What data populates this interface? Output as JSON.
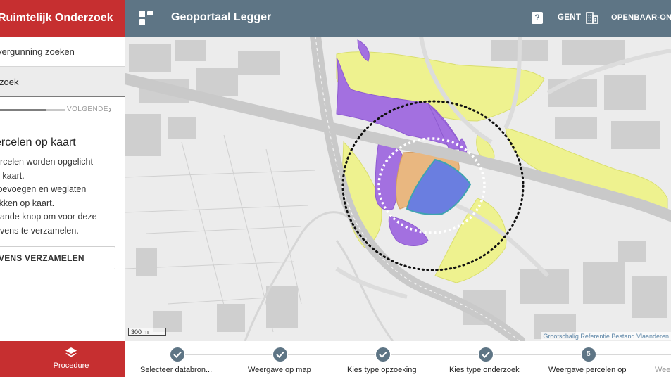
{
  "sidebar": {
    "header_title": "Ruimtelijk Onderzoek",
    "search_text": "vergunning zoeken",
    "step_text": "zoek",
    "next_label": "VOLGENDE",
    "progress": 0.72,
    "panel_title": "ercelen op kaart",
    "panel_lines": [
      "ercelen worden opgelicht",
      "p kaart.",
      " toevoegen en weglaten",
      "likken op kaart.",
      "aande knop om voor deze",
      "evens te verzamelen."
    ],
    "collect_button": "VENS VERZAMELEN",
    "footer_label": "Procedure",
    "footer_icon": "layers-icon"
  },
  "topbar": {
    "title": "Geoportaal Legger",
    "help_icon": "help-icon",
    "help_glyph": "?",
    "city": "GENT",
    "city_icon": "building-icon",
    "mode": "OPENBAAR-ONDERZ"
  },
  "map": {
    "scale_label": "300 m",
    "attribution": "Grootschalig Referentie Bestand Vlaanderen"
  },
  "stepper": {
    "steps": [
      {
        "label": "Selecteer databron...",
        "state": "done"
      },
      {
        "label": "Weergave op map",
        "state": "done"
      },
      {
        "label": "Kies type opzoeking",
        "state": "done"
      },
      {
        "label": "Kies type onderzoek",
        "state": "done"
      },
      {
        "label": "Weergave percelen op",
        "state": "current",
        "number": "5"
      },
      {
        "label": "Wee",
        "state": "todo"
      }
    ]
  },
  "colors": {
    "brand_red": "#c62f30",
    "topbar": "#5e7585",
    "zone_yellow": "#eef28f",
    "zone_purple": "#a370e0",
    "zone_orange": "#e9b780",
    "zone_blue": "#6a7ee0"
  }
}
